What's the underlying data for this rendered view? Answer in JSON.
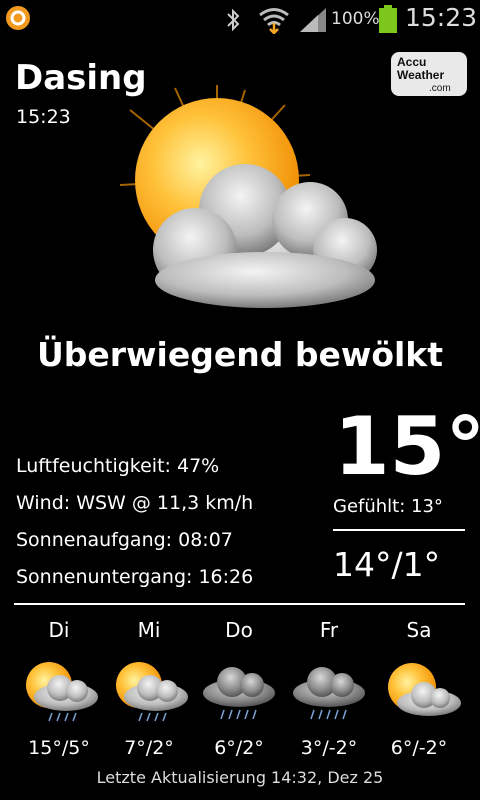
{
  "status_bar": {
    "battery_text": "100%",
    "time": "15:23",
    "app_icon": "notification-app-icon",
    "icons": [
      "bluetooth-icon",
      "wifi-icon",
      "signal-icon",
      "battery-icon"
    ]
  },
  "location": {
    "city": "Dasing",
    "time": "15:23"
  },
  "brand": {
    "line1": "Accu",
    "line2": "Weather",
    "line3": ".com"
  },
  "current": {
    "condition": "Überwiegend bewölkt",
    "icon": "sun-cloud-icon",
    "temp": "15°",
    "feels_like": "Gefühlt: 13°",
    "hi_lo": "14°/1°",
    "humidity": "Luftfeuchtigkeit: 47%",
    "wind": "Wind: WSW @ 11,3 km/h",
    "sunrise": "Sonnenaufgang: 08:07",
    "sunset": "Sonnenuntergang: 16:26"
  },
  "forecast": [
    {
      "day": "Di",
      "temps": "15°/5°",
      "icon": "sun-rain-cloud-icon"
    },
    {
      "day": "Mi",
      "temps": "7°/2°",
      "icon": "sun-rain-cloud-icon"
    },
    {
      "day": "Do",
      "temps": "6°/2°",
      "icon": "rain-cloud-icon"
    },
    {
      "day": "Fr",
      "temps": "3°/-2°",
      "icon": "rain-cloud-icon"
    },
    {
      "day": "Sa",
      "temps": "6°/-2°",
      "icon": "sun-cloud-icon"
    }
  ],
  "footer": "Letzte Aktualisierung 14:32, Dez 25",
  "colors": {
    "background": "#000000",
    "text": "#ffffff",
    "sun": "#ffb21f",
    "battery": "#7cc61d",
    "wifi_arrow": "#f5a623"
  }
}
